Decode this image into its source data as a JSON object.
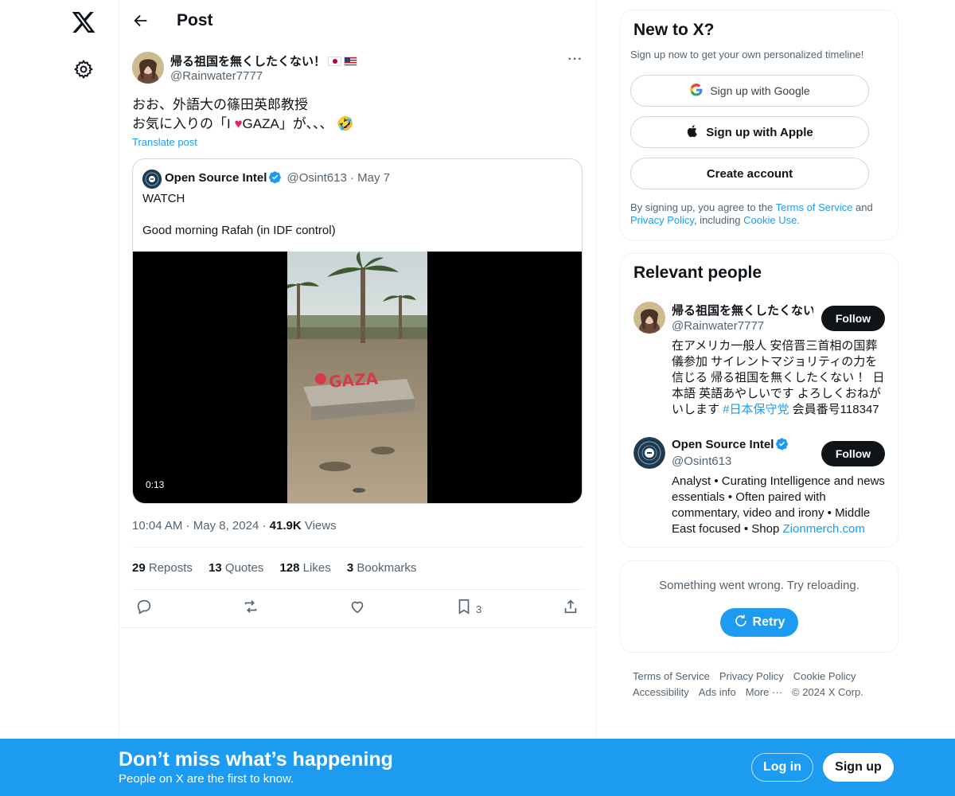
{
  "header": {
    "title": "Post"
  },
  "post": {
    "author_name": "帰る祖国を無くしたくない！",
    "author_handle": "@Rainwater7777",
    "text_line1": "おお、外語大の篠田英郎教授",
    "text_line2_before": "お気に入りの「I ",
    "text_line2_after": "GAZA」が、、、",
    "emoji": "🤣",
    "translate_label": "Translate post",
    "time": "10:04 AM",
    "date": "May 8, 2024",
    "views_count": "41.9K",
    "views_label": "Views",
    "stats": [
      {
        "count": "29",
        "label": "Reposts"
      },
      {
        "count": "13",
        "label": "Quotes"
      },
      {
        "count": "128",
        "label": "Likes"
      },
      {
        "count": "3",
        "label": "Bookmarks"
      }
    ],
    "bookmark_count": "3"
  },
  "quote": {
    "name": "Open Source Intel",
    "handle": "@Osint613",
    "date": "May 7",
    "text1": "WATCH",
    "text2": "Good morning Rafah (in IDF control)",
    "video_duration": "0:13",
    "sign_text": "GAZA"
  },
  "signup_card": {
    "title": "New to X?",
    "subtitle": "Sign up now to get your own personalized timeline!",
    "google_label": "Sign up with Google",
    "apple_label": "Sign up with Apple",
    "create_label": "Create account",
    "legal_prefix": "By signing up, you agree to the ",
    "terms": "Terms of Service",
    "and": " and ",
    "privacy": "Privacy Policy",
    "including": ", including ",
    "cookie": "Cookie Use."
  },
  "relevant": {
    "title": "Relevant people",
    "follow_label": "Follow",
    "people": [
      {
        "name": "帰る祖国を無くしたくない！",
        "handle": "@Rainwater7777",
        "bio": "在アメリカ一般人 安倍晋三首相の国葬儀参加 サイレントマジョリティの力を信じる 帰る祖国を無くしたくない ！ 日本語 英語あやしいです よろしくおねがいします ",
        "bio_tag": "#日本保守党",
        "bio_suffix": " 会員番号118347"
      },
      {
        "name": "Open Source Intel",
        "handle": "@Osint613",
        "bio": "Analyst • Curating Intelligence and news essentials • Often paired with commentary, video and irony • Middle East focused • Shop ",
        "bio_link": "Zionmerch.com"
      }
    ]
  },
  "error_card": {
    "text": "Something went wrong. Try reloading.",
    "retry_label": "Retry"
  },
  "footer": {
    "links": [
      "Terms of Service",
      "Privacy Policy",
      "Cookie Policy",
      "Accessibility",
      "Ads info",
      "More ···",
      "© 2024 X Corp."
    ]
  },
  "banner": {
    "title": "Don’t miss what’s happening",
    "subtitle": "People on X are the first to know.",
    "login_label": "Log in",
    "signup_label": "Sign up"
  },
  "colors": {
    "accent": "#1d9bf0",
    "text": "#0f1419",
    "muted": "#536471",
    "border": "#eff3f4"
  },
  "icons": [
    "x-logo-icon",
    "gear-icon",
    "back-arrow-icon",
    "more-icon",
    "verified-icon",
    "reply-icon",
    "repost-icon",
    "like-icon",
    "bookmark-icon",
    "share-icon",
    "google-icon",
    "apple-icon",
    "refresh-icon"
  ]
}
